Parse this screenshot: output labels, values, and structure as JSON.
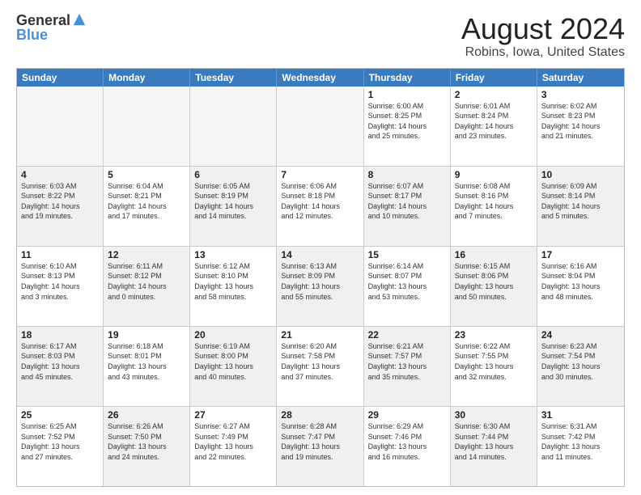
{
  "logo": {
    "general": "General",
    "blue": "Blue"
  },
  "title": "August 2024",
  "location": "Robins, Iowa, United States",
  "days": [
    "Sunday",
    "Monday",
    "Tuesday",
    "Wednesday",
    "Thursday",
    "Friday",
    "Saturday"
  ],
  "rows": [
    [
      {
        "day": "",
        "text": "",
        "empty": true
      },
      {
        "day": "",
        "text": "",
        "empty": true
      },
      {
        "day": "",
        "text": "",
        "empty": true
      },
      {
        "day": "",
        "text": "",
        "empty": true
      },
      {
        "day": "1",
        "text": "Sunrise: 6:00 AM\nSunset: 8:25 PM\nDaylight: 14 hours\nand 25 minutes."
      },
      {
        "day": "2",
        "text": "Sunrise: 6:01 AM\nSunset: 8:24 PM\nDaylight: 14 hours\nand 23 minutes."
      },
      {
        "day": "3",
        "text": "Sunrise: 6:02 AM\nSunset: 8:23 PM\nDaylight: 14 hours\nand 21 minutes."
      }
    ],
    [
      {
        "day": "4",
        "text": "Sunrise: 6:03 AM\nSunset: 8:22 PM\nDaylight: 14 hours\nand 19 minutes.",
        "shaded": true
      },
      {
        "day": "5",
        "text": "Sunrise: 6:04 AM\nSunset: 8:21 PM\nDaylight: 14 hours\nand 17 minutes."
      },
      {
        "day": "6",
        "text": "Sunrise: 6:05 AM\nSunset: 8:19 PM\nDaylight: 14 hours\nand 14 minutes.",
        "shaded": true
      },
      {
        "day": "7",
        "text": "Sunrise: 6:06 AM\nSunset: 8:18 PM\nDaylight: 14 hours\nand 12 minutes."
      },
      {
        "day": "8",
        "text": "Sunrise: 6:07 AM\nSunset: 8:17 PM\nDaylight: 14 hours\nand 10 minutes.",
        "shaded": true
      },
      {
        "day": "9",
        "text": "Sunrise: 6:08 AM\nSunset: 8:16 PM\nDaylight: 14 hours\nand 7 minutes."
      },
      {
        "day": "10",
        "text": "Sunrise: 6:09 AM\nSunset: 8:14 PM\nDaylight: 14 hours\nand 5 minutes.",
        "shaded": true
      }
    ],
    [
      {
        "day": "11",
        "text": "Sunrise: 6:10 AM\nSunset: 8:13 PM\nDaylight: 14 hours\nand 3 minutes."
      },
      {
        "day": "12",
        "text": "Sunrise: 6:11 AM\nSunset: 8:12 PM\nDaylight: 14 hours\nand 0 minutes.",
        "shaded": true
      },
      {
        "day": "13",
        "text": "Sunrise: 6:12 AM\nSunset: 8:10 PM\nDaylight: 13 hours\nand 58 minutes."
      },
      {
        "day": "14",
        "text": "Sunrise: 6:13 AM\nSunset: 8:09 PM\nDaylight: 13 hours\nand 55 minutes.",
        "shaded": true
      },
      {
        "day": "15",
        "text": "Sunrise: 6:14 AM\nSunset: 8:07 PM\nDaylight: 13 hours\nand 53 minutes."
      },
      {
        "day": "16",
        "text": "Sunrise: 6:15 AM\nSunset: 8:06 PM\nDaylight: 13 hours\nand 50 minutes.",
        "shaded": true
      },
      {
        "day": "17",
        "text": "Sunrise: 6:16 AM\nSunset: 8:04 PM\nDaylight: 13 hours\nand 48 minutes."
      }
    ],
    [
      {
        "day": "18",
        "text": "Sunrise: 6:17 AM\nSunset: 8:03 PM\nDaylight: 13 hours\nand 45 minutes.",
        "shaded": true
      },
      {
        "day": "19",
        "text": "Sunrise: 6:18 AM\nSunset: 8:01 PM\nDaylight: 13 hours\nand 43 minutes."
      },
      {
        "day": "20",
        "text": "Sunrise: 6:19 AM\nSunset: 8:00 PM\nDaylight: 13 hours\nand 40 minutes.",
        "shaded": true
      },
      {
        "day": "21",
        "text": "Sunrise: 6:20 AM\nSunset: 7:58 PM\nDaylight: 13 hours\nand 37 minutes."
      },
      {
        "day": "22",
        "text": "Sunrise: 6:21 AM\nSunset: 7:57 PM\nDaylight: 13 hours\nand 35 minutes.",
        "shaded": true
      },
      {
        "day": "23",
        "text": "Sunrise: 6:22 AM\nSunset: 7:55 PM\nDaylight: 13 hours\nand 32 minutes."
      },
      {
        "day": "24",
        "text": "Sunrise: 6:23 AM\nSunset: 7:54 PM\nDaylight: 13 hours\nand 30 minutes.",
        "shaded": true
      }
    ],
    [
      {
        "day": "25",
        "text": "Sunrise: 6:25 AM\nSunset: 7:52 PM\nDaylight: 13 hours\nand 27 minutes."
      },
      {
        "day": "26",
        "text": "Sunrise: 6:26 AM\nSunset: 7:50 PM\nDaylight: 13 hours\nand 24 minutes.",
        "shaded": true
      },
      {
        "day": "27",
        "text": "Sunrise: 6:27 AM\nSunset: 7:49 PM\nDaylight: 13 hours\nand 22 minutes."
      },
      {
        "day": "28",
        "text": "Sunrise: 6:28 AM\nSunset: 7:47 PM\nDaylight: 13 hours\nand 19 minutes.",
        "shaded": true
      },
      {
        "day": "29",
        "text": "Sunrise: 6:29 AM\nSunset: 7:46 PM\nDaylight: 13 hours\nand 16 minutes."
      },
      {
        "day": "30",
        "text": "Sunrise: 6:30 AM\nSunset: 7:44 PM\nDaylight: 13 hours\nand 14 minutes.",
        "shaded": true
      },
      {
        "day": "31",
        "text": "Sunrise: 6:31 AM\nSunset: 7:42 PM\nDaylight: 13 hours\nand 11 minutes."
      }
    ]
  ]
}
